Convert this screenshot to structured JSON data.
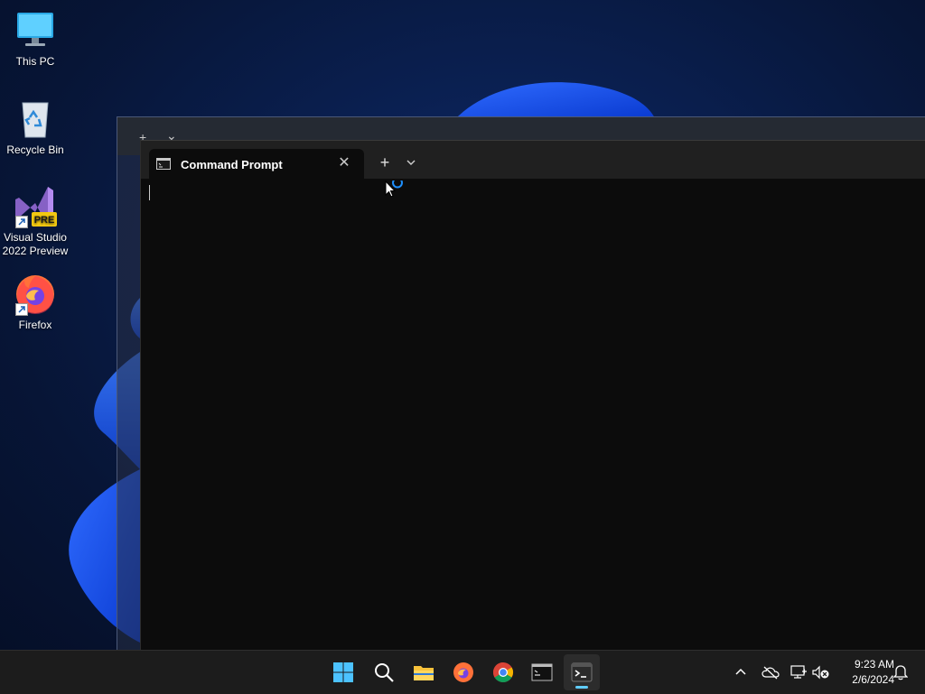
{
  "desktop": {
    "icons": [
      {
        "label": "This PC"
      },
      {
        "label": "Recycle Bin"
      },
      {
        "label": "Visual Studio 2022 Preview",
        "badge": "PRE"
      },
      {
        "label": "Firefox"
      }
    ]
  },
  "back_window": {
    "new_tab_glyph": "+",
    "dropdown_glyph": "⌄"
  },
  "terminal": {
    "tab_title": "Command Prompt",
    "tab_close_glyph": "✕",
    "new_tab_glyph": "+",
    "tab_dropdown_icon": "chevron-down-icon"
  },
  "taskbar": {
    "apps": [
      "windows-start-icon",
      "search-icon",
      "file-explorer-icon",
      "firefox-icon",
      "chrome-icon",
      "command-prompt-icon",
      "windows-terminal-icon"
    ],
    "active_app": "windows-terminal-icon",
    "tray": [
      "chevron-up-icon",
      "cloud-offline-icon",
      "network-icon",
      "volume-muted-icon"
    ],
    "clock": {
      "time": "9:23 AM",
      "date": "2/6/2024"
    },
    "notification_icon": "bell-icon"
  },
  "colors": {
    "accent": "#60cdff",
    "terminal_bg": "#0c0c0c",
    "tabbar_bg": "#202020",
    "taskbar_bg": "#1c1c1c"
  }
}
